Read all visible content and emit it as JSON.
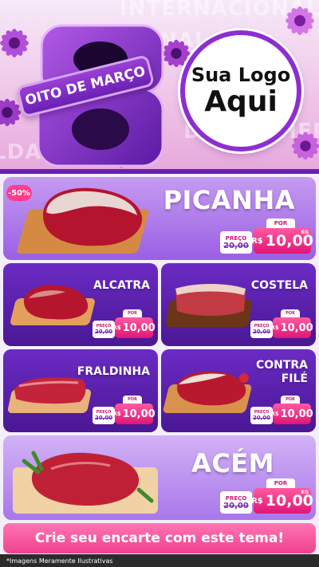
{
  "header": {
    "background_words": [
      "INTERNACIONAL DA MU",
      "NAL",
      "DA MULHER",
      "ALDA MU"
    ],
    "numeral": "8",
    "ribbon_text": "OITO DE MARÇO",
    "logo_line1": "Sua Logo",
    "logo_line2": "Aqui",
    "accent": "#6a1fb0",
    "pink": "#f0418f"
  },
  "products": {
    "picanha": {
      "name": "PICANHA",
      "discount": "-50%",
      "old_label": "PREÇO",
      "old_price": "20,00",
      "por": "POR",
      "currency": "R$",
      "new_price": "10,00",
      "unit": "KG"
    },
    "alcatra": {
      "name": "ALCATRA",
      "old_label": "PREÇO",
      "old_price": "20,00",
      "por": "POR",
      "currency": "R$",
      "new_price": "10,00"
    },
    "costela": {
      "name": "COSTELA",
      "old_label": "PREÇO",
      "old_price": "20,00",
      "por": "POR",
      "currency": "R$",
      "new_price": "10,00"
    },
    "fraldinha": {
      "name": "FRALDINHA",
      "old_label": "PREÇO",
      "old_price": "20,00",
      "por": "POR",
      "currency": "R$",
      "new_price": "10,00"
    },
    "contrafile": {
      "name_line1": "CONTRA",
      "name_line2": "FILÉ",
      "old_label": "PREÇO",
      "old_price": "20,00",
      "por": "POR",
      "currency": "R$",
      "new_price": "10,00"
    },
    "acem": {
      "name": "ACÉM",
      "old_label": "PREÇO",
      "old_price": "20,00",
      "por": "POR",
      "currency": "R$",
      "new_price": "10,00",
      "unit": "KG"
    }
  },
  "cta": {
    "label": "Crie seu encarte com este tema!"
  },
  "footer": {
    "disclaimer": "*Imagens Meramente Ilustrativas"
  }
}
